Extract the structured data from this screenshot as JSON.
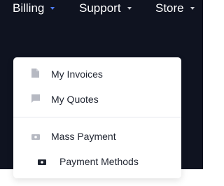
{
  "nav": {
    "items": [
      {
        "label": "Billing",
        "active": true
      },
      {
        "label": "Support",
        "active": false
      },
      {
        "label": "Store",
        "active": false
      }
    ]
  },
  "dropdown": {
    "items": [
      {
        "label": "My Invoices",
        "icon": "document-icon"
      },
      {
        "label": "My Quotes",
        "icon": "comment-icon"
      },
      {
        "label": "Mass Payment",
        "icon": "cash-icon"
      },
      {
        "label": "Payment Methods",
        "icon": "payment-card-icon"
      }
    ]
  },
  "colors": {
    "nav_background": "#0f1320",
    "nav_text": "#ffffff",
    "active_caret": "#4f7cff",
    "dropdown_background": "#ffffff",
    "dropdown_text": "#1f2430",
    "icon_gray": "#b6b9c2"
  }
}
